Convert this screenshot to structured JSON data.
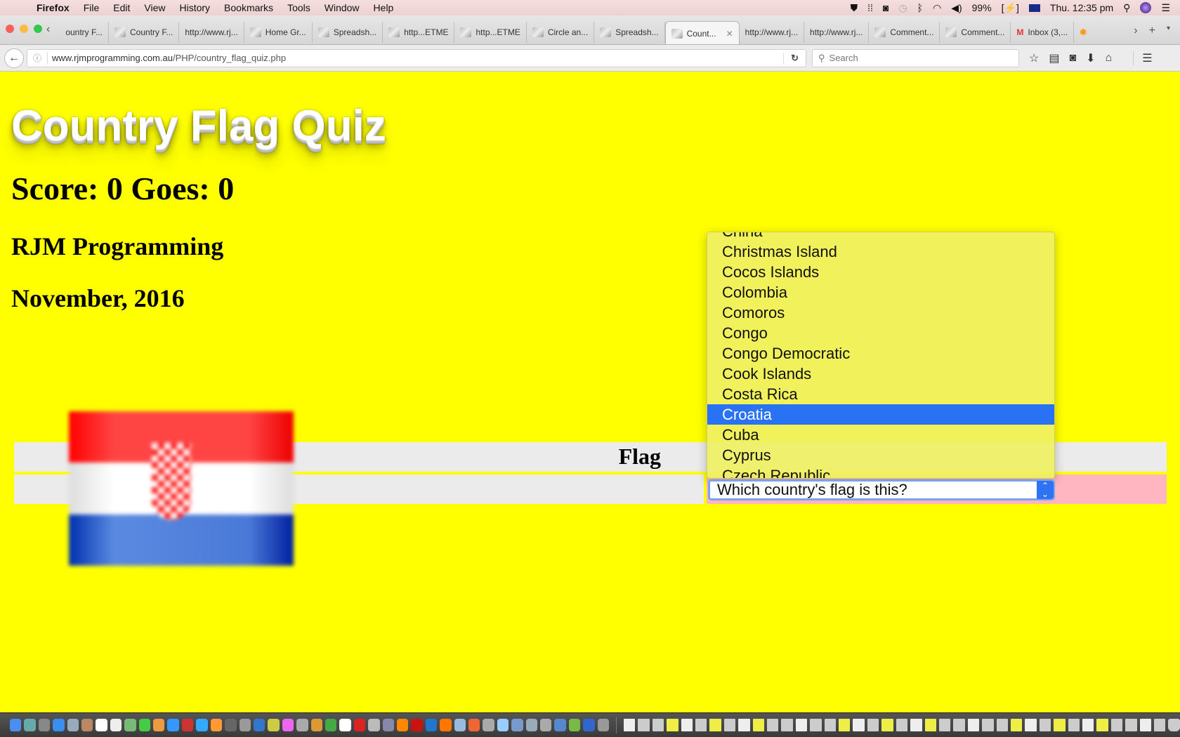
{
  "menubar": {
    "app": "Firefox",
    "items": [
      "File",
      "Edit",
      "View",
      "History",
      "Bookmarks",
      "Tools",
      "Window",
      "Help"
    ],
    "battery": "99%",
    "clock": "Thu. 12:35 pm"
  },
  "tabs": [
    {
      "label": "ountry F...",
      "active": false
    },
    {
      "label": "Country F...",
      "active": false
    },
    {
      "label": "http://www.rj...",
      "active": false
    },
    {
      "label": "Home Gr...",
      "active": false
    },
    {
      "label": "Spreadsh...",
      "active": false
    },
    {
      "label": "http...ETME",
      "active": false
    },
    {
      "label": "http...ETME",
      "active": false
    },
    {
      "label": "Circle an...",
      "active": false
    },
    {
      "label": "Spreadsh...",
      "active": false
    },
    {
      "label": "Count...",
      "active": true
    },
    {
      "label": "http://www.rj...",
      "active": false
    },
    {
      "label": "http://www.rj...",
      "active": false
    },
    {
      "label": "Comment...",
      "active": false
    },
    {
      "label": "Comment...",
      "active": false
    },
    {
      "label": "Inbox (3,...",
      "active": false
    }
  ],
  "navbar": {
    "url_host": "www.rjmprogramming.com.au",
    "url_path": "/PHP/country_flag_quiz.php",
    "search_placeholder": "Search"
  },
  "page": {
    "title": "Country Flag Quiz",
    "score_line": "Score: 0 Goes: 0",
    "author": "RJM Programming",
    "date": "November, 2016",
    "table_header": "Flag",
    "flag_country_shown": "Croatia",
    "select": {
      "current_value": "Which country's flag is this?",
      "options_visible": [
        "China",
        "Christmas Island",
        "Cocos Islands",
        "Colombia",
        "Comoros",
        "Congo",
        "Congo Democratic",
        "Cook Islands",
        "Costa Rica",
        "Croatia",
        "Cuba",
        "Cyprus",
        "Czech Republic"
      ],
      "highlighted": "Croatia"
    }
  },
  "colors": {
    "page_bg": "#ffff00",
    "row_bg": "#ebebeb",
    "answer_cell_bg": "#ffb6c1",
    "highlight": "#2a72f4"
  }
}
